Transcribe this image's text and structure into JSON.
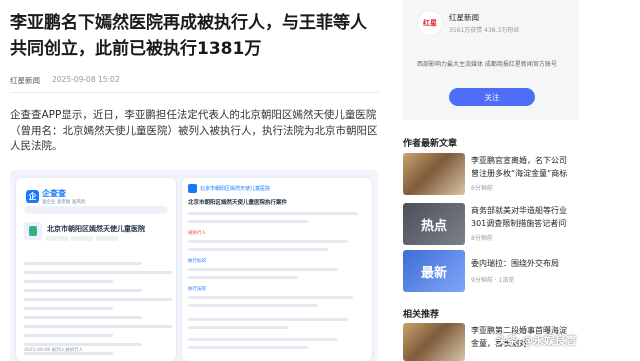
{
  "article": {
    "title": "李亚鹏名下嫣然医院再成被执行人，与王菲等人共同创立，此前已被执行1381万",
    "source": "红星新闻",
    "date": "2025-09-08 15:02",
    "body": "企查查APP显示，近日，李亚鹏担任法定代表人的北京朝阳区嫣然天使儿童医院（曾用名：北京嫣然天使儿童医院）被列入被执行人，执行法院为北京市朝阳区人民法院。"
  },
  "embed": {
    "app_name": "企查查",
    "app_tagline": "查企业 查老板 查风险",
    "company": "北京市朝阳区嫣然天使儿童医院",
    "panel_header": "北京市朝阳区嫣然天使儿童医院",
    "panel_title": "北京市朝阳区嫣然天使儿童医院执行案件",
    "amount_label": "执行标的",
    "court_label": "执行法院",
    "status_label": "被执行人",
    "footer": "2025-09-08 被列入被执行人"
  },
  "sidebar": {
    "author": {
      "name": "红星新闻",
      "stats": "3561万获赞 438.3万粉丝",
      "desc": "西部影响力最大主流媒体 成都商报红星新闻官方账号",
      "follow_label": "关注",
      "avatar_text": "红星"
    },
    "latest_heading": "作者最新文章",
    "latest": [
      {
        "title": "李亚鹏官宣离婚，名下公司曾注册多枚“海淀金童”商标",
        "time": "6分钟前"
      },
      {
        "title": "商务部就美对华造船等行业301调查限制措施答记者问",
        "time": "8分钟前",
        "thumb_text": "热点"
      },
      {
        "title": "委内瑞拉：围绕外交布局",
        "time": "9分钟前 · 1浏览",
        "thumb_text": "最新"
      }
    ],
    "related_heading": "相关推荐",
    "related": [
      {
        "title": "李亚鹏第二段婚事首曝海淀金童，喜长期对",
        "time": ""
      }
    ]
  },
  "watermark": "头条 @永娱良言"
}
